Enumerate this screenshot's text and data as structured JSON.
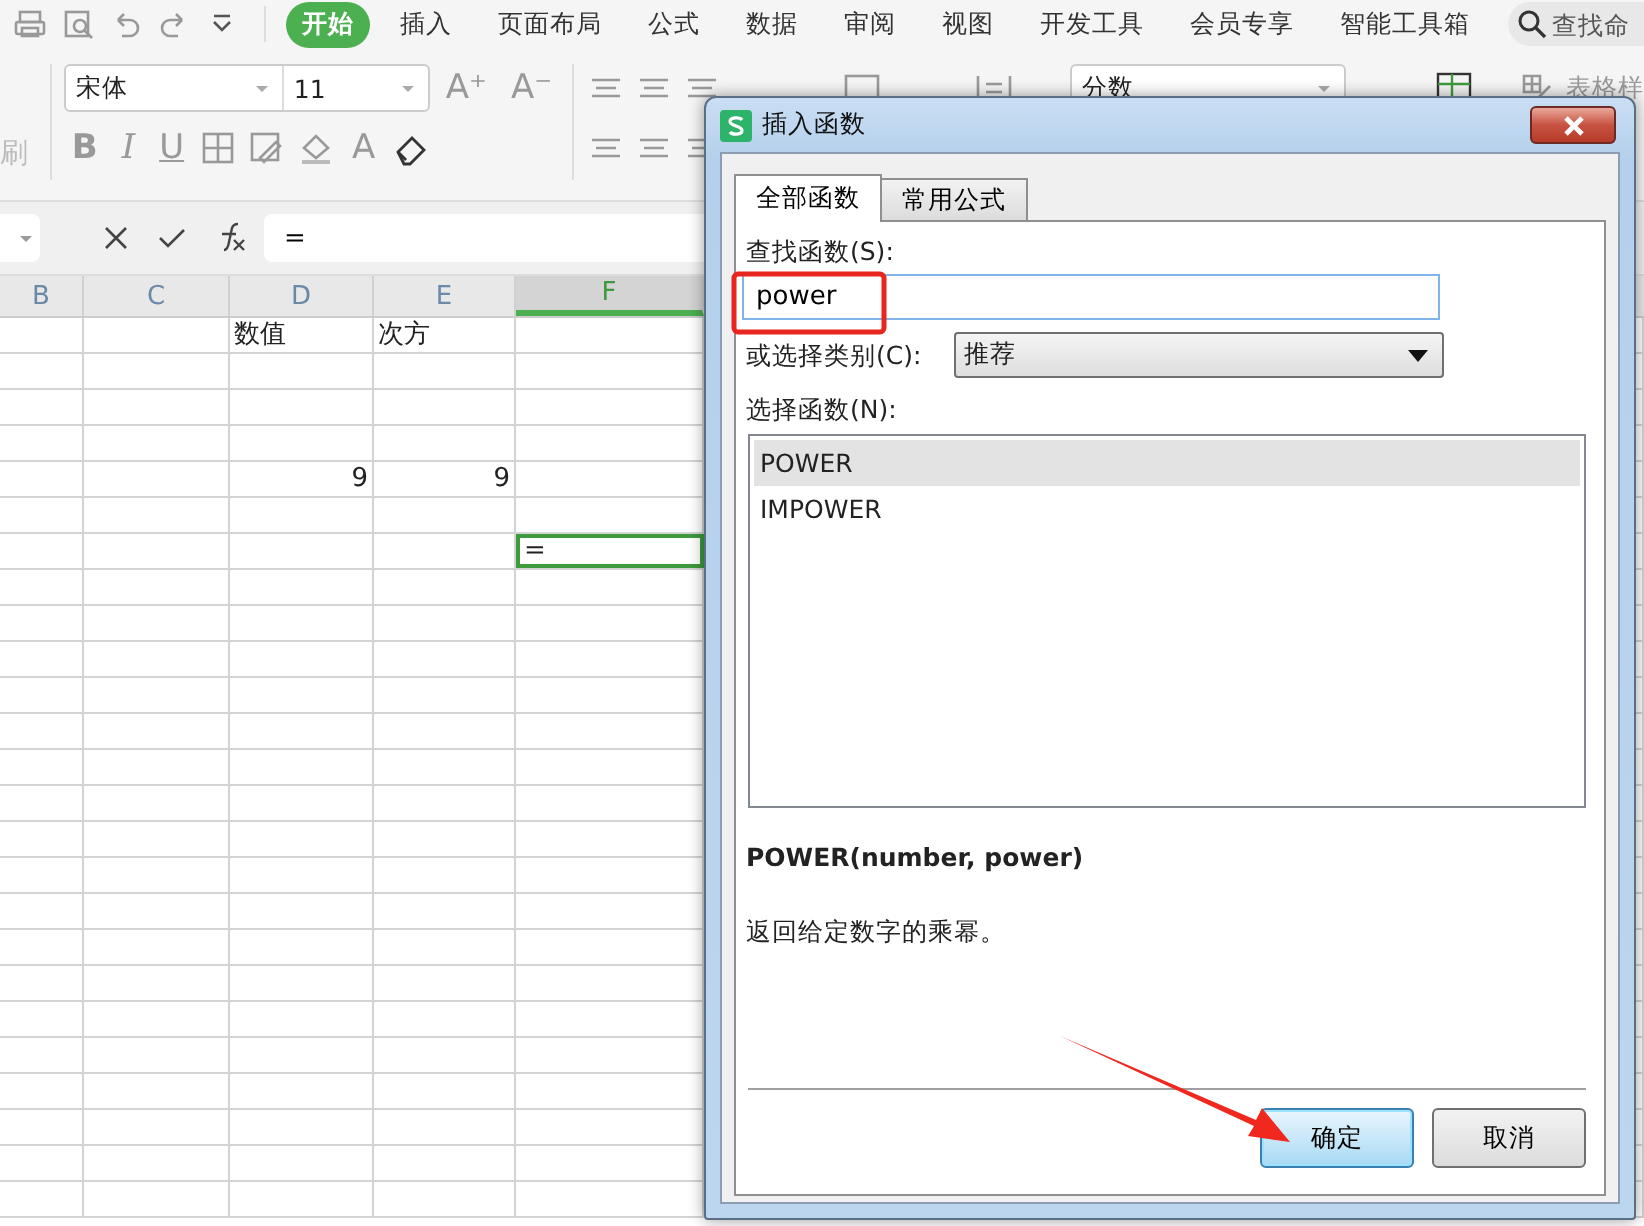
{
  "ribbon_tabs": [
    {
      "label": "开始",
      "selected": true
    },
    {
      "label": "插入",
      "selected": false
    },
    {
      "label": "页面布局",
      "selected": false
    },
    {
      "label": "公式",
      "selected": false
    },
    {
      "label": "数据",
      "selected": false
    },
    {
      "label": "审阅",
      "selected": false
    },
    {
      "label": "视图",
      "selected": false
    },
    {
      "label": "开发工具",
      "selected": false
    },
    {
      "label": "会员专享",
      "selected": false
    },
    {
      "label": "智能工具箱",
      "selected": false
    }
  ],
  "command_search": {
    "placeholder": "查找命"
  },
  "toolbar": {
    "format_painter_label": "刷",
    "font_name": "宋体",
    "font_size": "11",
    "size_buttons": [
      "A⁺",
      "A⁻"
    ],
    "style_buttons": [
      "B",
      "I",
      "U"
    ],
    "font_color_button": "A",
    "number_format": "分数",
    "table_style_label": "表格样"
  },
  "formula_bar": {
    "formula": "="
  },
  "sheet": {
    "columns": [
      {
        "label": "B",
        "selected": false
      },
      {
        "label": "C",
        "selected": false
      },
      {
        "label": "D",
        "selected": false
      },
      {
        "label": "E",
        "selected": false
      },
      {
        "label": "F",
        "selected": true
      }
    ],
    "rows": [
      {
        "cells": [
          {
            "selected": false
          },
          {
            "selected": false
          },
          {
            "kind": "text",
            "text": "数值",
            "selected": false
          },
          {
            "kind": "text",
            "text": "次方",
            "selected": false
          },
          {
            "selected": false
          }
        ]
      },
      {
        "cells": [
          {
            "selected": false
          },
          {
            "selected": false
          },
          {
            "selected": false
          },
          {
            "selected": false
          },
          {
            "selected": false
          }
        ]
      },
      {
        "cells": [
          {
            "selected": false
          },
          {
            "selected": false
          },
          {
            "selected": false
          },
          {
            "selected": false
          },
          {
            "selected": false
          }
        ]
      },
      {
        "cells": [
          {
            "selected": false
          },
          {
            "selected": false
          },
          {
            "selected": false
          },
          {
            "selected": false
          },
          {
            "selected": false
          }
        ]
      },
      {
        "cells": [
          {
            "selected": false
          },
          {
            "selected": false
          },
          {
            "kind": "number",
            "text": "9",
            "selected": false
          },
          {
            "kind": "number",
            "text": "9",
            "selected": false
          },
          {
            "selected": false
          }
        ]
      },
      {
        "cells": [
          {
            "selected": false
          },
          {
            "selected": false
          },
          {
            "selected": false
          },
          {
            "selected": false
          },
          {
            "selected": false
          }
        ]
      },
      {
        "cells": [
          {
            "selected": false
          },
          {
            "selected": false
          },
          {
            "selected": false
          },
          {
            "selected": false
          },
          {
            "kind": "text",
            "text": "=",
            "selected": true
          }
        ]
      }
    ]
  },
  "dialog": {
    "title": "插入函数",
    "tabs": [
      {
        "label": "全部函数",
        "selected": true
      },
      {
        "label": "常用公式",
        "selected": false
      }
    ],
    "search_label": "查找函数(S):",
    "search_value": "power",
    "category_label": "或选择类别(C):",
    "category_value": "推荐",
    "list_label": "选择函数(N):",
    "functions": [
      {
        "name": "POWER",
        "selected": true
      },
      {
        "name": "IMPOWER",
        "selected": false
      }
    ],
    "signature": "POWER(number, power)",
    "description": "返回给定数字的乘幂。",
    "buttons": [
      {
        "label": "确定",
        "default": true
      },
      {
        "label": "取消",
        "default": false
      }
    ]
  }
}
